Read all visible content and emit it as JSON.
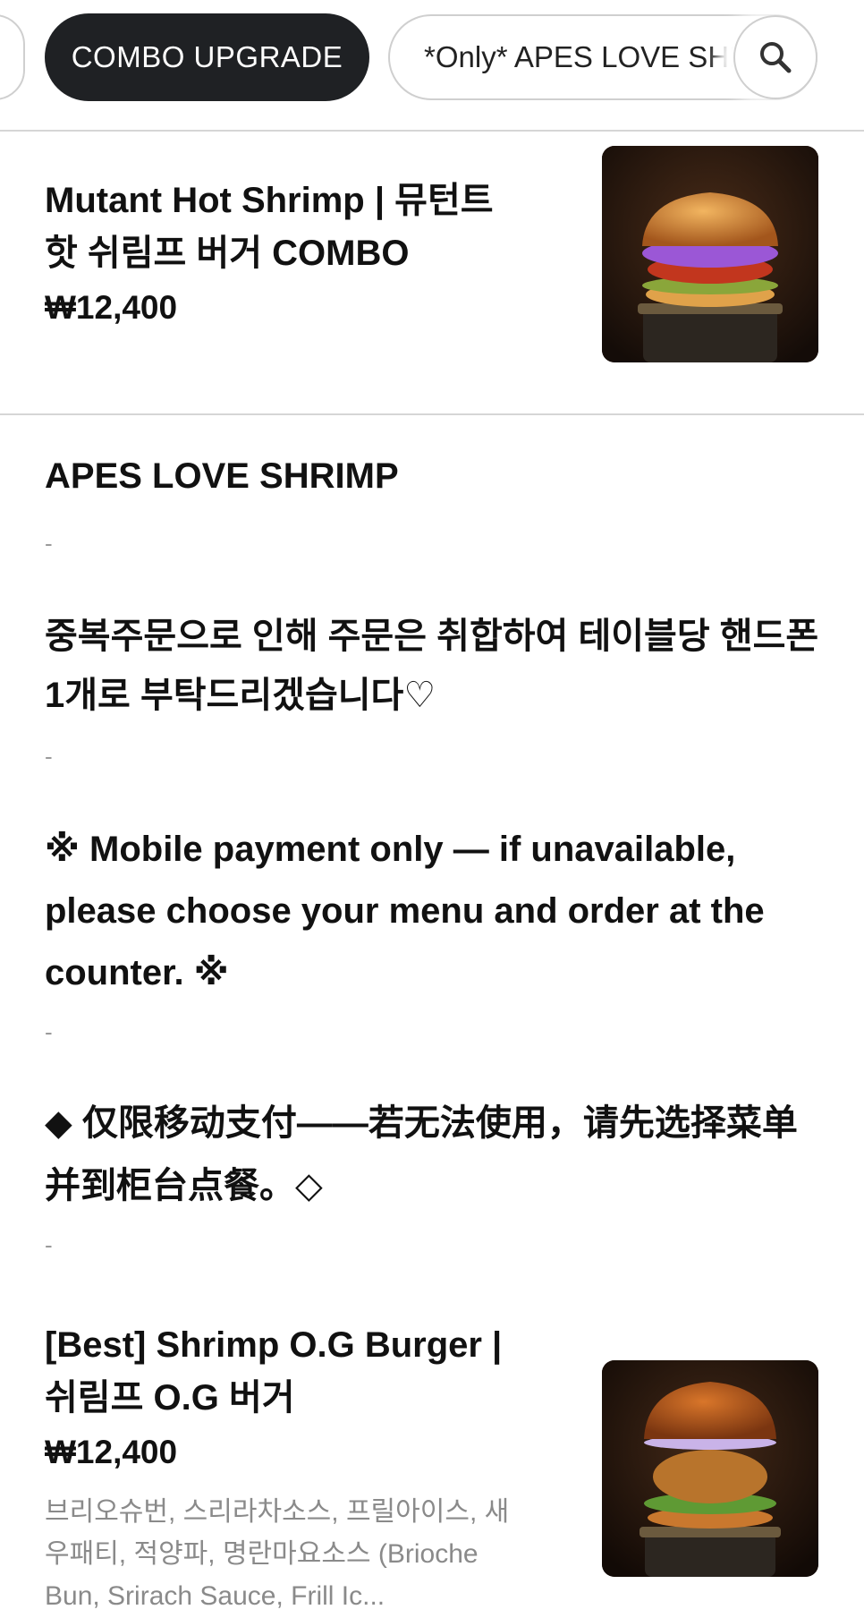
{
  "tabs": {
    "combo_label": "COMBO UPGRADE",
    "only_label": "*Only* APES LOVE SHRIMP",
    "search_icon": "magnifier"
  },
  "items": [
    {
      "name": "Mutant Hot Shrimp | 뮤턴트 핫 쉬림프 버거 COMBO",
      "price": "₩12,400",
      "image": "burger-purple-cabbage"
    },
    {
      "name": "[Best] Shrimp O.G Burger | 쉬림프 O.G 버거",
      "price": "₩12,400",
      "description": "브리오슈번, 스리라차소스, 프릴아이스, 새우패티, 적양파, 명란마요소스 (Brioche Bun, Srirach Sauce, Frill Ic...",
      "image": "burger-shrimp-patty"
    }
  ],
  "section": {
    "title": "APES LOVE SHRIMP",
    "separator": "-",
    "notice_ko": "중복주문으로 인해 주문은 취합하여 테이블당 핸드폰 1개로 부탁드리겠습니다♡",
    "notice_en": "※ Mobile payment only — if unavailable, please choose your menu and order at the counter. ※",
    "notice_zh": "◆ 仅限移动支付——若无法使用，请先选择菜单并到柜台点餐。◇"
  },
  "colors": {
    "active_tab_bg": "#1f2124",
    "divider": "#d6d6d6",
    "muted_text": "#8a8a8a"
  }
}
